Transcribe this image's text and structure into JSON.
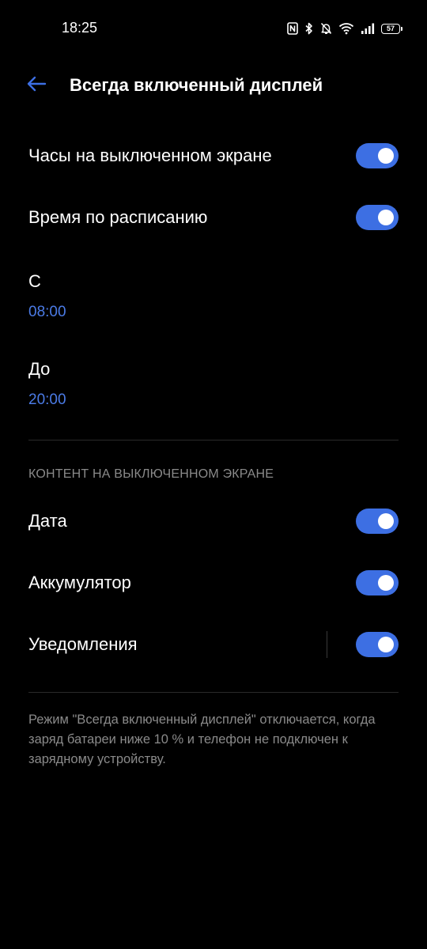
{
  "status_bar": {
    "time": "18:25",
    "icons": [
      "nfc-icon",
      "bluetooth-icon",
      "mute-icon",
      "wifi-icon",
      "signal-icon"
    ],
    "battery": "57"
  },
  "header": {
    "back_icon": "arrow-left-icon",
    "title": "Всегда включенный дисплей"
  },
  "settings": {
    "clock_off_screen": {
      "label": "Часы на выключенном экране",
      "on": true
    },
    "scheduled_time": {
      "label": "Время по расписанию",
      "on": true
    },
    "from": {
      "label": "С",
      "value": "08:00"
    },
    "to": {
      "label": "До",
      "value": "20:00"
    }
  },
  "content_section": {
    "header": "КОНТЕНТ НА ВЫКЛЮЧЕННОМ ЭКРАНЕ",
    "items": [
      {
        "label": "Дата",
        "on": true
      },
      {
        "label": "Аккумулятор",
        "on": true
      },
      {
        "label": "Уведомления",
        "on": true
      }
    ]
  },
  "footnote": "Режим \"Всегда включенный дисплей\" отключается, когда заряд батареи ниже 10 % и телефон не подключен к зарядному устройству.",
  "colors": {
    "background": "#000000",
    "accent": "#3d6fe3",
    "time_value": "#4b7be6",
    "secondary_text": "#8a8a8a"
  }
}
